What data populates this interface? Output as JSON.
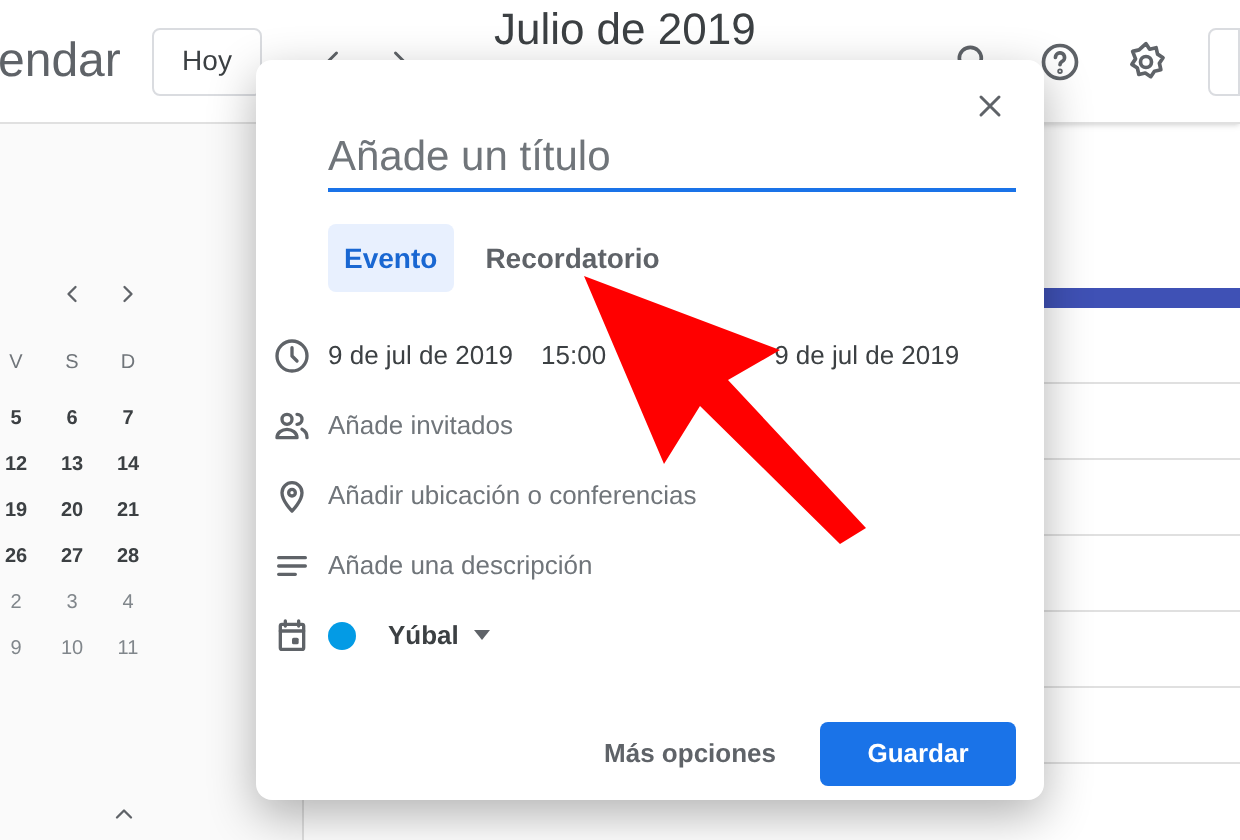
{
  "header": {
    "app_title": "endar",
    "today_button": "Hoy",
    "month": "Julio de 2019"
  },
  "mini_calendar": {
    "weekdays": [
      "V",
      "S",
      "D"
    ],
    "weeks": [
      {
        "days": [
          "5",
          "6",
          "7"
        ],
        "other_month": false
      },
      {
        "days": [
          "12",
          "13",
          "14"
        ],
        "other_month": false
      },
      {
        "days": [
          "19",
          "20",
          "21"
        ],
        "other_month": false
      },
      {
        "days": [
          "26",
          "27",
          "28"
        ],
        "other_month": false
      },
      {
        "days": [
          "2",
          "3",
          "4"
        ],
        "other_month": true
      },
      {
        "days": [
          "9",
          "10",
          "11"
        ],
        "other_month": true
      }
    ]
  },
  "dialog": {
    "title_placeholder": "Añade un título",
    "tabs": [
      {
        "label": "Evento",
        "selected": true
      },
      {
        "label": "Recordatorio",
        "selected": false
      }
    ],
    "when": {
      "start_date": "9 de jul de 2019",
      "start_time": "15:00",
      "end_date": "9 de jul de 2019"
    },
    "fields": [
      {
        "kind": "guests",
        "text": "Añade invitados"
      },
      {
        "kind": "location",
        "text": "Añadir ubicación o conferencias"
      },
      {
        "kind": "description",
        "text": "Añade una descripción"
      }
    ],
    "calendar": {
      "name": "Yúbal",
      "color": "#039be5"
    },
    "buttons": {
      "more_options": "Más opciones",
      "save": "Guardar"
    }
  }
}
